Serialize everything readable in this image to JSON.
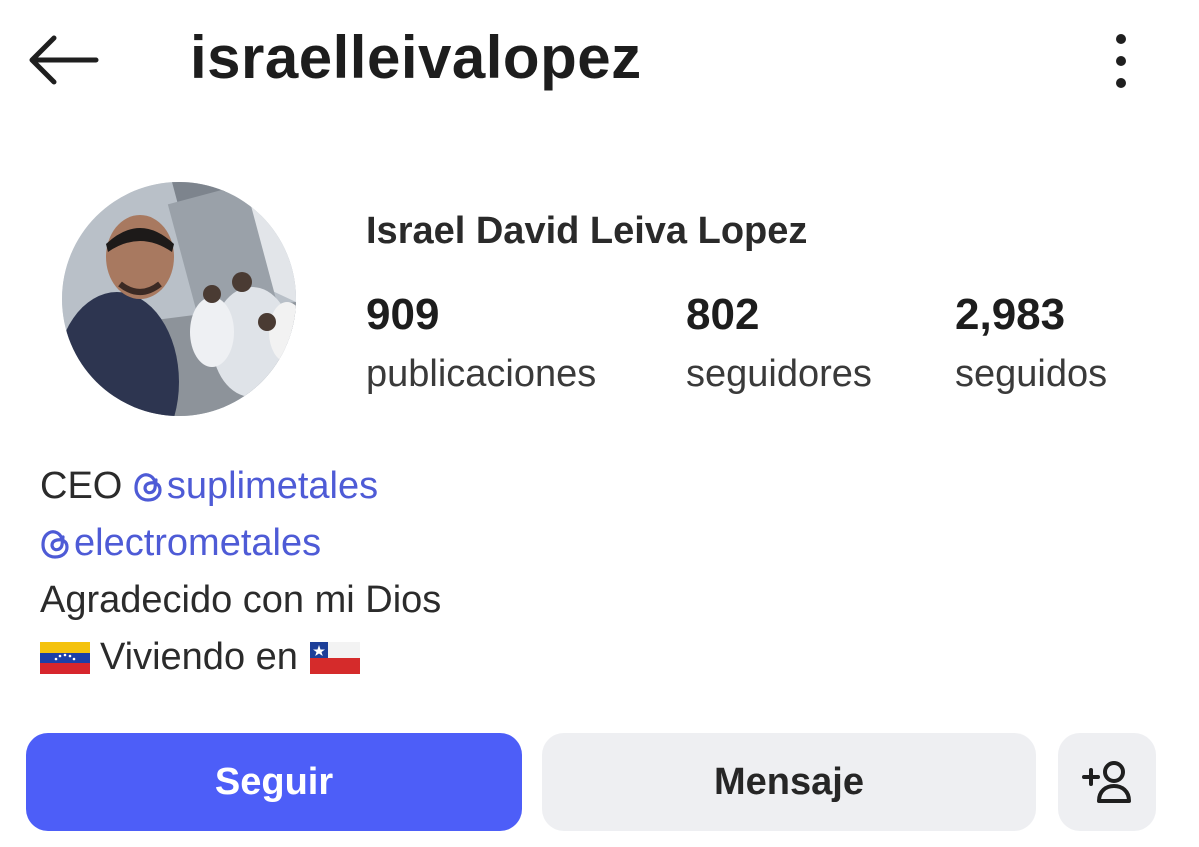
{
  "header": {
    "back_icon": "arrow-left-icon",
    "username": "israelleivalopez",
    "more_icon": "more-vertical-icon"
  },
  "profile": {
    "avatar_icon": "profile-photo",
    "full_name": "Israel David Leiva Lopez",
    "stats": [
      {
        "value": "909",
        "label": "publicaciones"
      },
      {
        "value": "802",
        "label": "seguidores"
      },
      {
        "value": "2,983",
        "label": "seguidos"
      }
    ]
  },
  "bio": {
    "line1_prefix": "CEO ",
    "mention1": "suplimetales",
    "mention2": "electrometales",
    "line3": "Agradecido con mi Dios",
    "line4": "Viviendo en",
    "flag_left": "flag-venezuela",
    "flag_right": "flag-chile",
    "mention_color": "#4e5bd6"
  },
  "actions": {
    "follow_label": "Seguir",
    "message_label": "Mensaje",
    "add_user_icon": "person-add-icon",
    "follow_color": "#4d5ef8",
    "secondary_color": "#eeeff2"
  }
}
